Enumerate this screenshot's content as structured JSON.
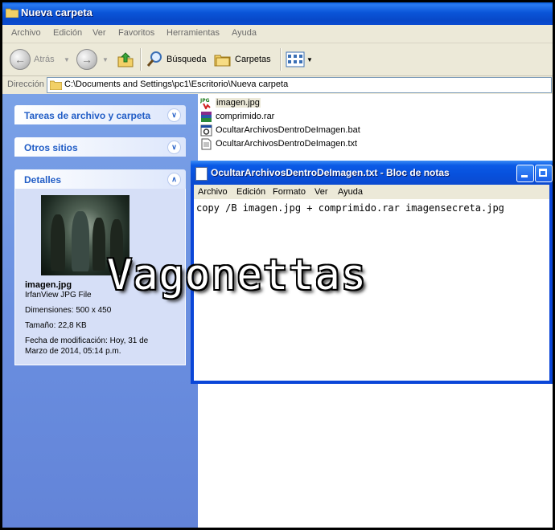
{
  "window": {
    "title": "Nueva carpeta"
  },
  "menu": [
    "Archivo",
    "Edición",
    "Ver",
    "Favoritos",
    "Herramientas",
    "Ayuda"
  ],
  "toolbar": {
    "back_label": "Atrás",
    "search_label": "Búsqueda",
    "folders_label": "Carpetas"
  },
  "address": {
    "label": "Dirección",
    "path": "C:\\Documents and Settings\\pc1\\Escritorio\\Nueva carpeta"
  },
  "tasks": {
    "file_tasks": "Tareas de archivo y carpeta",
    "other_places": "Otros sitios",
    "details": "Detalles"
  },
  "details": {
    "name": "imagen.jpg",
    "type": "IrfanView JPG File",
    "dimensions": "Dimensiones: 500 x 450",
    "size": "Tamaño: 22,8 KB",
    "modified_1": "Fecha de modificación: Hoy, 31 de",
    "modified_2": "Marzo de 2014, 05:14 p.m."
  },
  "files": [
    {
      "name": "imagen.jpg",
      "icon": "jpg-file-icon"
    },
    {
      "name": "comprimido.rar",
      "icon": "rar-file-icon"
    },
    {
      "name": "OcultarArchivosDentroDeImagen.bat",
      "icon": "bat-file-icon"
    },
    {
      "name": "OcultarArchivosDentroDeImagen.txt",
      "icon": "txt-file-icon"
    }
  ],
  "notepad": {
    "title": "OcultarArchivosDentroDeImagen.txt - Bloc de notas",
    "menu": [
      "Archivo",
      "Edición",
      "Formato",
      "Ver",
      "Ayuda"
    ],
    "content": "copy /B imagen.jpg + comprimido.rar imagensecreta.jpg"
  },
  "watermark": "Vagonettas",
  "colors": {
    "titlebar": "#0a55d8",
    "taskpane": "#6a8fe0",
    "panel_title": "#215dc6"
  }
}
